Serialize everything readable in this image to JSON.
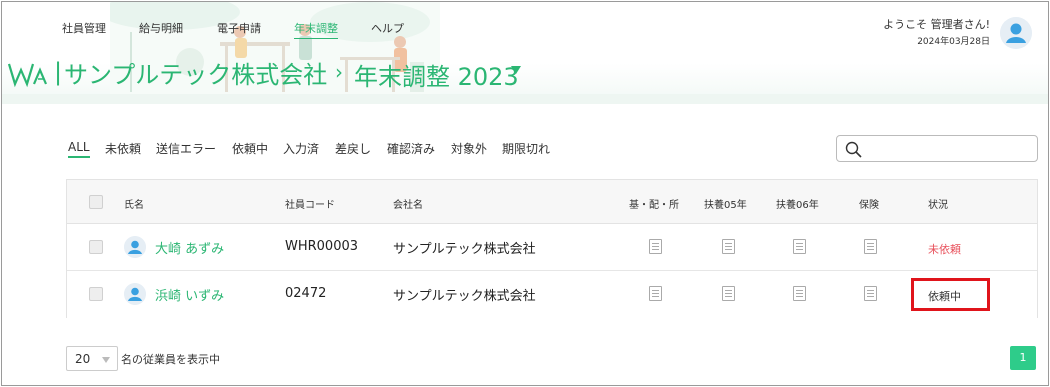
{
  "nav": {
    "items": [
      "社員管理",
      "給与明細",
      "電子申請",
      "年末調整",
      "ヘルプ"
    ],
    "active_index": 3
  },
  "header": {
    "company": "サンプルテック株式会社",
    "breadcrumb_separator": "›",
    "page_title": "年末調整 2023",
    "welcome": "ようこそ 管理者さん!",
    "date": "2024年03月28日"
  },
  "filters": [
    "ALL",
    "未依頼",
    "送信エラー",
    "依頼中",
    "入力済",
    "差戻し",
    "確認済み",
    "対象外",
    "期限切れ"
  ],
  "filter_active_index": 0,
  "search": {
    "placeholder": "",
    "icon": "search-icon"
  },
  "table": {
    "columns": [
      "氏名",
      "社員コード",
      "会社名",
      "基・配・所",
      "扶養05年",
      "扶養06年",
      "保険",
      "状況"
    ],
    "rows": [
      {
        "name": "大崎 あずみ",
        "code": "WHR00003",
        "company": "サンプルテック株式会社",
        "status": "未依頼",
        "status_color": "#e8505b"
      },
      {
        "name": "浜崎 いずみ",
        "code": "02472",
        "company": "サンプルテック株式会社",
        "status": "依頼中",
        "status_color": "#333333"
      }
    ]
  },
  "footer": {
    "page_size": "20",
    "shown_label": "名の従業員を表示中",
    "current_page": "1"
  },
  "colors": {
    "accent": "#2bb673",
    "highlight": "#e0141b",
    "pager": "#2ecc8a"
  }
}
